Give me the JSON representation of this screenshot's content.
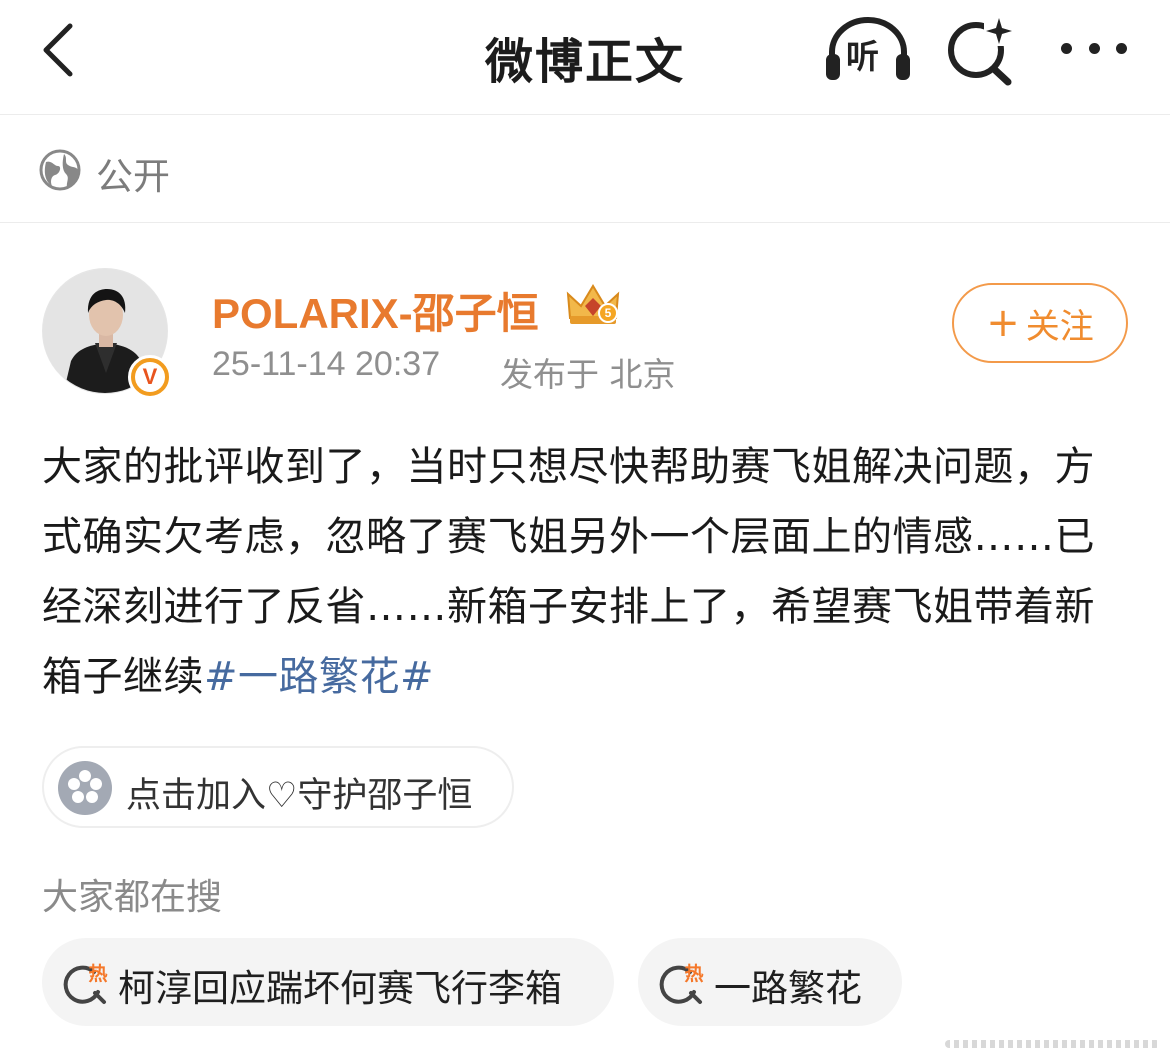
{
  "nav": {
    "title": "微博正文",
    "listen_label": "听"
  },
  "visibility": {
    "label": "公开"
  },
  "author": {
    "name": "POLARIX-邵子恒",
    "verified_mark": "V",
    "time": "25-11-14 20:37",
    "location": "发布于 北京",
    "follow_plus": "+",
    "follow_label": "关注"
  },
  "post": {
    "text": "大家的批评收到了，当时只想尽快帮助赛飞姐解决问题，方式确实欠考虑，忽略了赛飞姐另外一个层面上的情感……已经深刻进行了反省……新箱子安排上了，希望赛飞姐带着新箱子继续",
    "topic": "#一路繁花#"
  },
  "supertopic": {
    "label": "点击加入♡守护邵子恒"
  },
  "searches": {
    "heading": "大家都在搜",
    "items": [
      {
        "label": "柯淳回应踹坏何赛飞行李箱",
        "icon": "hot-search-icon"
      },
      {
        "label": "一路繁花",
        "icon": "hot-search-icon"
      }
    ],
    "hot_badge": "热"
  },
  "colors": {
    "accent": "#f08c2f",
    "author_name": "#e87a2e",
    "topic_link": "#466a9f",
    "verified_badge": "#f29c1f"
  }
}
